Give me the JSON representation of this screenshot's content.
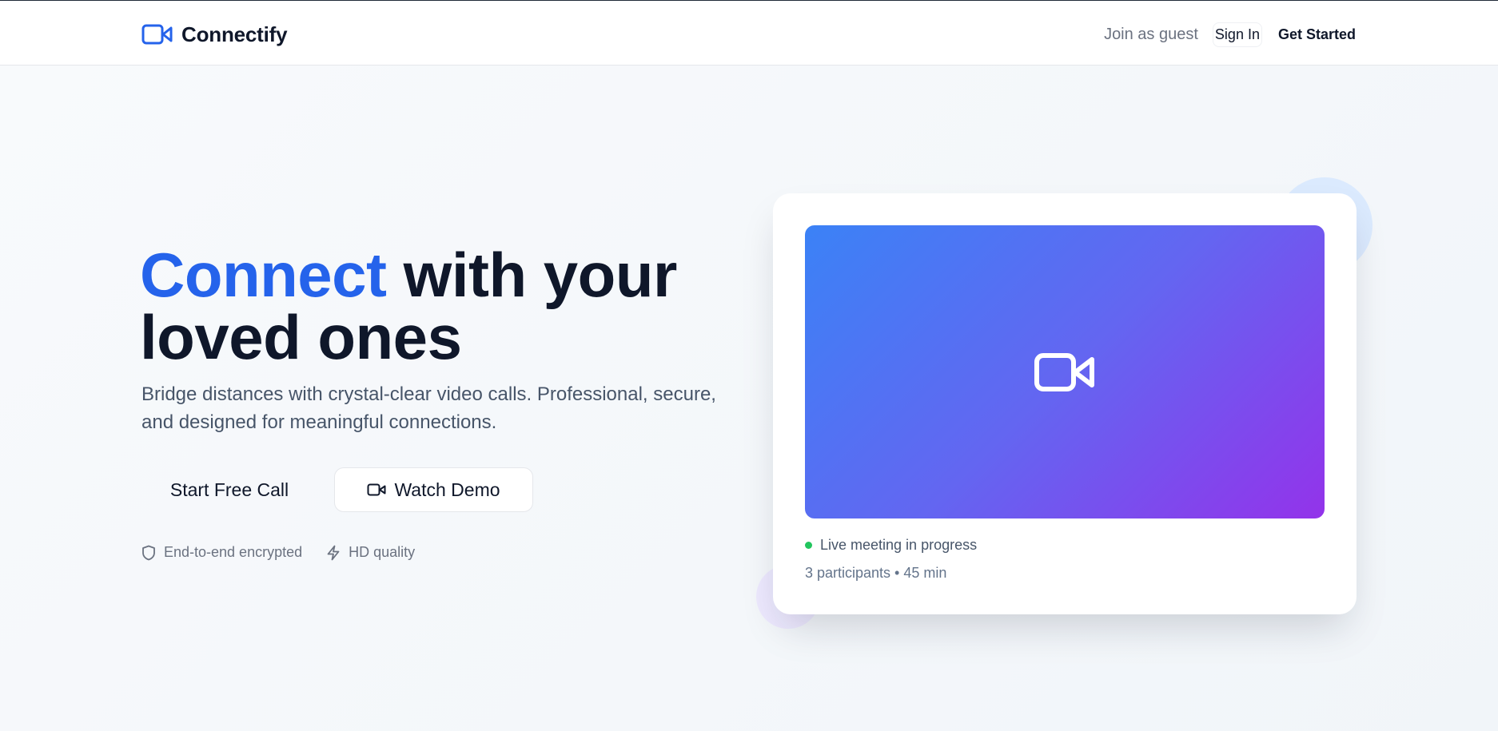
{
  "header": {
    "logo_icon": "video-camera-icon",
    "brand": "Connectify",
    "nav": {
      "guest_label": "Join as guest",
      "signin_label": "Sign In",
      "get_started_label": "Get Started"
    }
  },
  "hero": {
    "title_accent": "Connect",
    "title_rest": " with your loved ones",
    "subtitle": "Bridge distances with crystal-clear video calls. Professional, secure, and designed for meaningful connections.",
    "primary_cta": "Start Free Call",
    "secondary_cta": "Watch Demo",
    "secondary_cta_icon": "video-camera-icon",
    "features": [
      {
        "icon": "shield-icon",
        "label": "End-to-end encrypted"
      },
      {
        "icon": "lightning-icon",
        "label": "HD quality"
      }
    ]
  },
  "preview_card": {
    "video_icon": "video-camera-icon",
    "status_label": "Live meeting in progress",
    "status_color": "#22c55e",
    "meta": "3 participants • 45 min"
  },
  "colors": {
    "accent": "#2563eb",
    "gradient_start": "#3b82f6",
    "gradient_end": "#9333ea",
    "heading": "#0f172a"
  }
}
